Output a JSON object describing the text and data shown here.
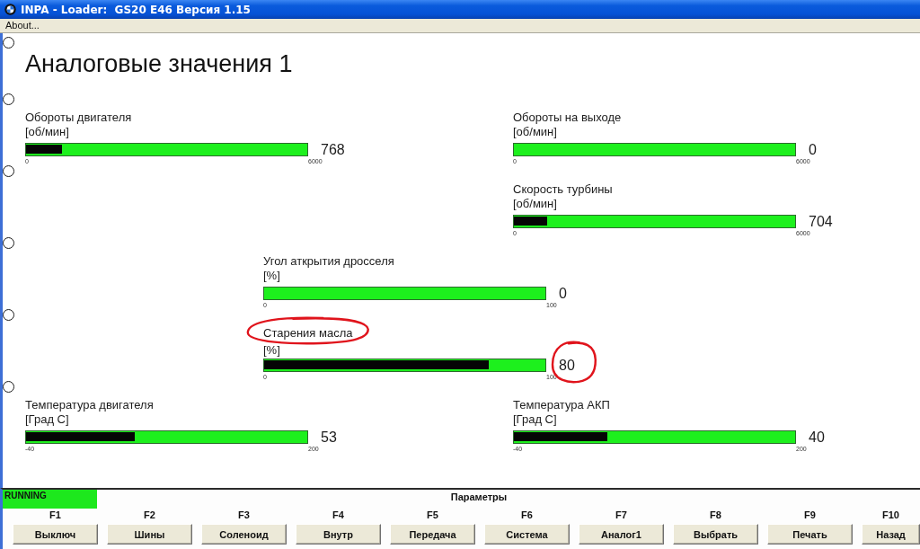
{
  "window": {
    "title": "INPA - Loader:  GS20 E46 Версия 1.15"
  },
  "menu": [
    {
      "label": "About..."
    }
  ],
  "screen": {
    "radio": {
      "selected": false
    },
    "title": "Аналоговые значения 1",
    "rows": [
      {
        "radio": {
          "selected": false
        },
        "left": {
          "label": "Обороты двигателя",
          "unit": "[об/мин]",
          "min": "0",
          "max": "6000",
          "value": "768",
          "level": 0.128,
          "circled": false
        },
        "right": {
          "label": "Обороты на выходе",
          "unit": "[об/мин]",
          "min": "0",
          "max": "6000",
          "value": "0",
          "level": 0,
          "circled": false
        }
      },
      {
        "radio": {
          "selected": false
        },
        "right": {
          "label": "Скорость турбины",
          "unit": "[об/мин]",
          "min": "0",
          "max": "6000",
          "value": "704",
          "level": 0.117,
          "circled": false
        }
      },
      {
        "radio": {
          "selected": false
        },
        "center": {
          "label": "Угол аткрытия дросселя",
          "unit": "[%]",
          "min": "0",
          "max": "100",
          "value": "0",
          "level": 0,
          "circled": false
        }
      },
      {
        "radio": {
          "selected": false
        },
        "center": {
          "label": "Старения масла",
          "unit": "[%]",
          "min": "0",
          "max": "100",
          "value": "80",
          "level": 0.8,
          "circled": true
        }
      },
      {
        "radio": {
          "selected": false
        },
        "left": {
          "label": "Температура двигателя",
          "unit": "[Град С]",
          "min": "-40",
          "max": "200",
          "value": "53",
          "level": 0.388,
          "circled": false
        },
        "right": {
          "label": "Температура АКП",
          "unit": "[Град С]",
          "min": "-40",
          "max": "200",
          "value": "40",
          "level": 0.333,
          "circled": false
        }
      }
    ]
  },
  "status": {
    "text": "RUNNING"
  },
  "panel_title": "Параметры",
  "function_keys": [
    {
      "key": "F1",
      "label": "Выключ"
    },
    {
      "key": "F2",
      "label": "Шины"
    },
    {
      "key": "F3",
      "label": "Соленоид"
    },
    {
      "key": "F4",
      "label": "Внутр"
    },
    {
      "key": "F5",
      "label": "Передача"
    },
    {
      "key": "F6",
      "label": "Система"
    },
    {
      "key": "F7",
      "label": "Аналог1"
    },
    {
      "key": "F8",
      "label": "Выбрать"
    },
    {
      "key": "F9",
      "label": "Печать"
    },
    {
      "key": "F10",
      "label": "Назад"
    }
  ]
}
